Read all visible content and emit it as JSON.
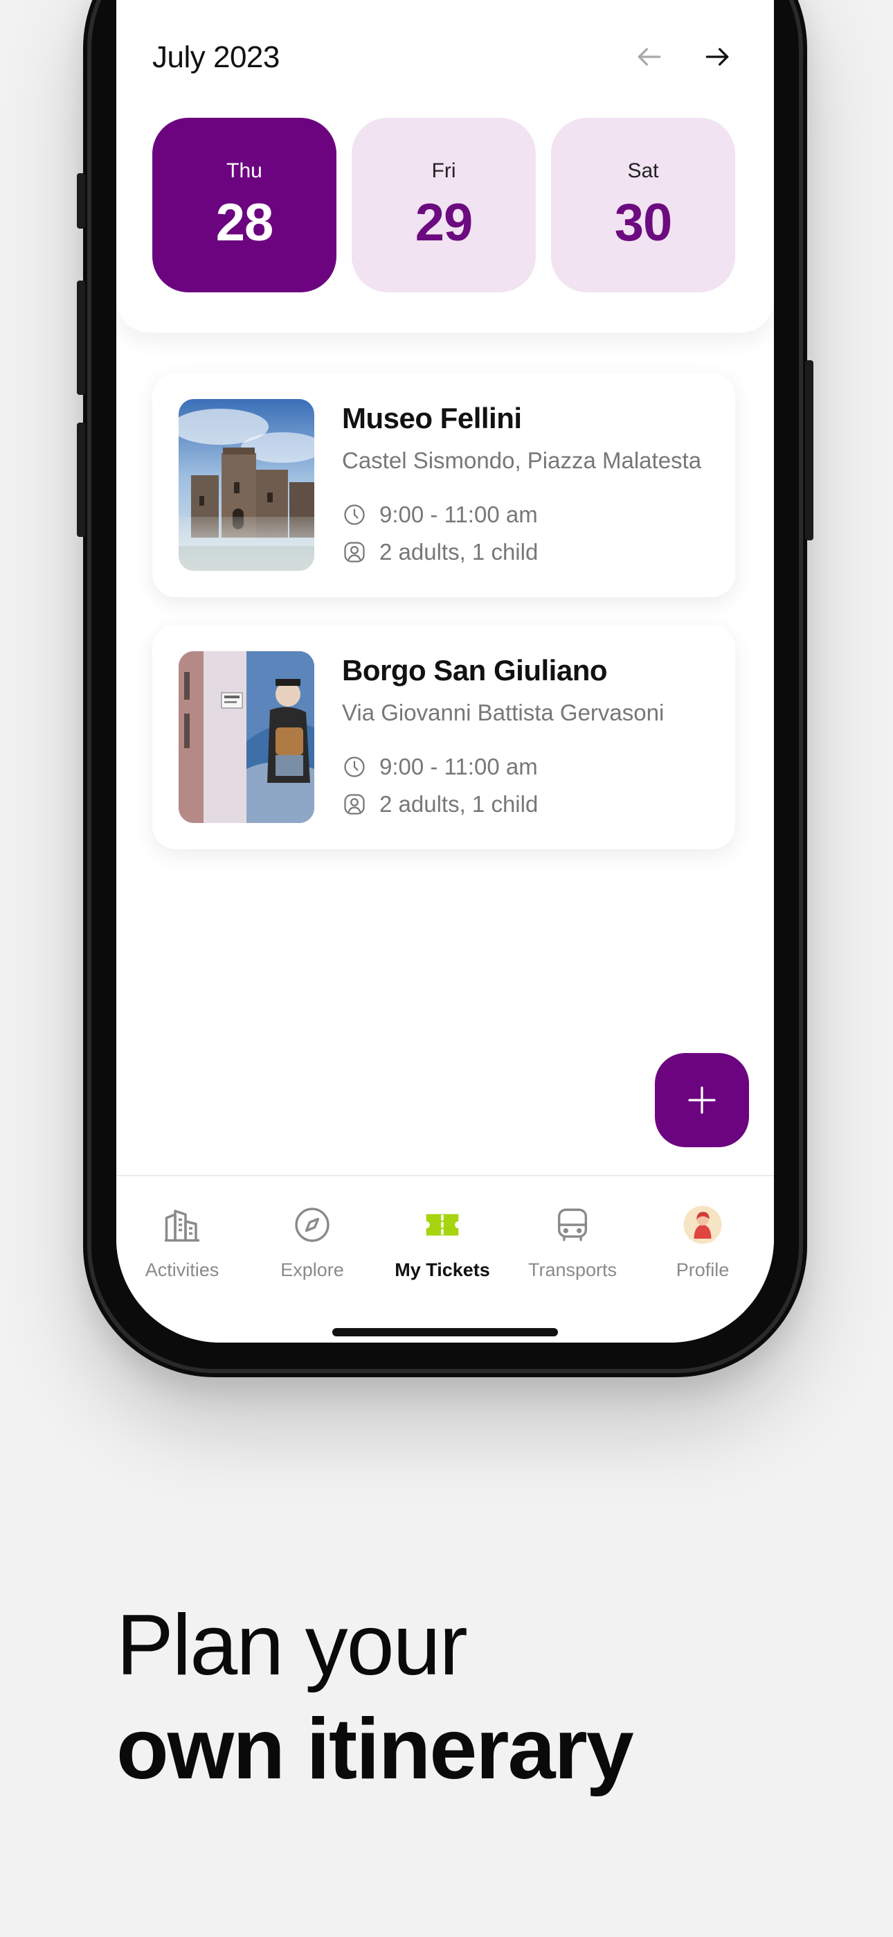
{
  "calendar": {
    "month_label": "July 2023",
    "prev_icon": "arrow-left-icon",
    "next_icon": "arrow-right-icon",
    "days": [
      {
        "name": "Thu",
        "number": "28",
        "selected": true
      },
      {
        "name": "Fri",
        "number": "29",
        "selected": false
      },
      {
        "name": "Sat",
        "number": "30",
        "selected": false
      }
    ]
  },
  "tickets": [
    {
      "title": "Museo Fellini",
      "address": "Castel Sismondo, Piazza Malatesta",
      "time": "9:00 - 11:00 am",
      "guests": "2 adults, 1 child",
      "image": "castle-photo"
    },
    {
      "title": "Borgo San Giuliano",
      "address": "Via Giovanni Battista Gervasoni",
      "time": "9:00 - 11:00 am",
      "guests": "2 adults, 1 child",
      "image": "mural-photo"
    }
  ],
  "fab": {
    "icon": "plus-icon"
  },
  "tabbar": {
    "items": [
      {
        "label": "Activities",
        "icon": "buildings-icon",
        "active": false
      },
      {
        "label": "Explore",
        "icon": "compass-icon",
        "active": false
      },
      {
        "label": "My Tickets",
        "icon": "ticket-icon",
        "active": true
      },
      {
        "label": "Transports",
        "icon": "bus-icon",
        "active": false
      },
      {
        "label": "Profile",
        "icon": "avatar-icon",
        "active": false
      }
    ]
  },
  "tagline": {
    "line1": "Plan your",
    "line2": "own itinerary"
  },
  "colors": {
    "primary": "#6c0480",
    "primary_light": "#f1e3f1",
    "accent_green": "#a6d40f",
    "background": "#f2f2f2"
  }
}
